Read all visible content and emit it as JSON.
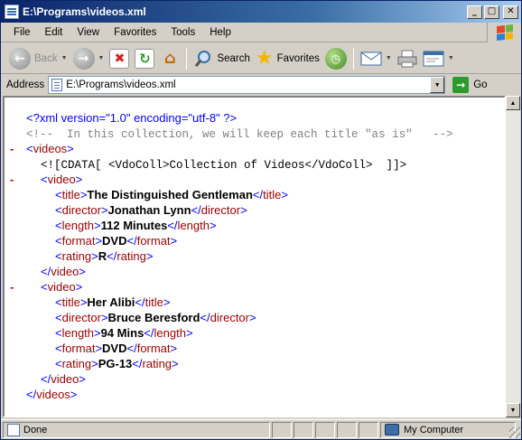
{
  "window": {
    "title": "E:\\Programs\\videos.xml",
    "controls": [
      "_",
      "□",
      "✕"
    ]
  },
  "menu": [
    "File",
    "Edit",
    "View",
    "Favorites",
    "Tools",
    "Help"
  ],
  "toolbar": {
    "back_label": "Back",
    "search_label": "Search",
    "favorites_label": "Favorites"
  },
  "address": {
    "label": "Address",
    "value": "E:\\Programs\\videos.xml",
    "go_label": "Go"
  },
  "xml": {
    "declaration": "<?xml version=\"1.0\" encoding=\"utf-8\" ?>",
    "comment": "<!--  In this collection, we will keep each title \"as is\"   -->",
    "cdata": "<![CDATA[ <VdoColl>Collection of Videos</VdoColl>  ]]>",
    "root_tag": "videos",
    "item_tag": "video",
    "videos": [
      [
        {
          "tag": "title",
          "value": "The Distinguished Gentleman"
        },
        {
          "tag": "director",
          "value": "Jonathan Lynn"
        },
        {
          "tag": "length",
          "value": "112 Minutes"
        },
        {
          "tag": "format",
          "value": "DVD"
        },
        {
          "tag": "rating",
          "value": "R"
        }
      ],
      [
        {
          "tag": "title",
          "value": "Her Alibi"
        },
        {
          "tag": "director",
          "value": "Bruce Beresford"
        },
        {
          "tag": "length",
          "value": "94 Mins"
        },
        {
          "tag": "format",
          "value": "DVD"
        },
        {
          "tag": "rating",
          "value": "PG-13"
        }
      ]
    ],
    "collapse_glyph": "-"
  },
  "status": {
    "text": "Done",
    "zone": "My Computer"
  }
}
